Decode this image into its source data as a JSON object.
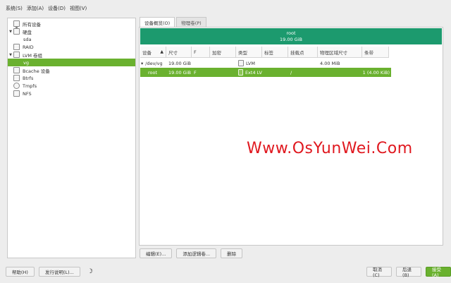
{
  "menu": [
    "系统(S)",
    "添加(A)",
    "设备(D)",
    "视图(V)"
  ],
  "tree": [
    {
      "label": "所有设备",
      "icon": "monitor-icon",
      "indent": 0,
      "arrow": ""
    },
    {
      "label": "硬盘",
      "icon": "disk-icon",
      "indent": 0,
      "arrow": "▼"
    },
    {
      "label": "sda",
      "icon": "",
      "indent": 1,
      "arrow": ""
    },
    {
      "label": "RAID",
      "icon": "raid-icon",
      "indent": 0,
      "arrow": ""
    },
    {
      "label": "LVM 卷组",
      "icon": "lvm-icon",
      "indent": 0,
      "arrow": "▼"
    },
    {
      "label": "vg",
      "icon": "",
      "indent": 1,
      "arrow": "",
      "selected": true
    },
    {
      "label": "Bcache 设备",
      "icon": "bcache-icon",
      "indent": 0,
      "arrow": ""
    },
    {
      "label": "Btrfs",
      "icon": "btrfs-icon",
      "indent": 0,
      "arrow": ""
    },
    {
      "label": "Tmpfs",
      "icon": "tmpfs-icon",
      "indent": 0,
      "arrow": ""
    },
    {
      "label": "NFS",
      "icon": "nfs-icon",
      "indent": 0,
      "arrow": ""
    }
  ],
  "tabs": [
    "设备概览(O)",
    "物理卷(P)"
  ],
  "volume_bar": {
    "name": "root",
    "size": "19.00 GiB"
  },
  "table": {
    "columns": [
      "设备",
      "尺寸",
      "F",
      "加密",
      "类型",
      "标签",
      "挂载点",
      "物理区域尺寸",
      "条带"
    ],
    "rows": [
      {
        "device": "/dev/vg",
        "size": "19.00 GiB",
        "f": "",
        "enc": "",
        "type": "LVM",
        "label": "",
        "mount": "",
        "pe": "4.00 MiB",
        "stripes": "",
        "expander": "▾"
      },
      {
        "device": "root",
        "size": "19.00 GiB",
        "f": "F",
        "enc": "",
        "type": "Ext4 LV",
        "label": "",
        "mount": "/",
        "pe": "",
        "stripes": "1 (4.00 KiB)",
        "expander": "",
        "selected": true
      }
    ]
  },
  "actions": {
    "edit": "编辑(E)...",
    "add_lv": "添加逻辑卷...",
    "delete": "删除"
  },
  "bottom": {
    "help": "帮助(H)",
    "release_notes": "发行说明(L)...",
    "cancel": "取消(C)",
    "back": "后退(B)",
    "accept": "接受(A)"
  },
  "watermark": "Www.OsYunWei.Com",
  "colors": {
    "accent": "#6ab12f",
    "volume_bar": "#1c9a6e",
    "watermark": "#e0181f"
  }
}
